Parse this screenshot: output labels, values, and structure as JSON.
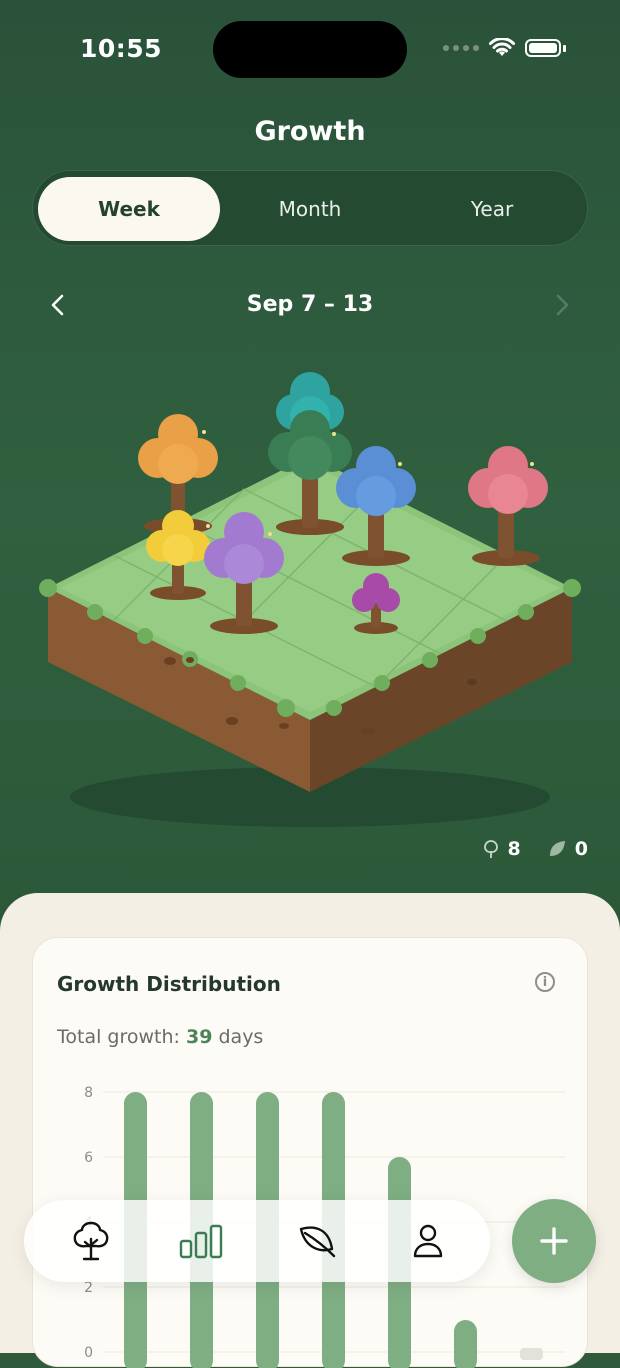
{
  "status_bar": {
    "time": "10:55"
  },
  "header": {
    "title": "Growth"
  },
  "segments": [
    {
      "label": "Week",
      "active": true
    },
    {
      "label": "Month",
      "active": false
    },
    {
      "label": "Year",
      "active": false
    }
  ],
  "range": {
    "label": "Sep 7 – 13",
    "prev_icon": "chevron-left-icon",
    "next_icon": "chevron-right-icon"
  },
  "counters": {
    "trees": "8",
    "leaves": "0"
  },
  "distribution": {
    "title": "Growth Distribution",
    "total_prefix": "Total growth:",
    "total_value": "39",
    "total_suffix": "days"
  },
  "chart_data": {
    "type": "bar",
    "y_ticks": [
      "8",
      "6",
      "4",
      "2",
      "0"
    ],
    "values": [
      8,
      8,
      8,
      8,
      6,
      0,
      0
    ],
    "ylim": [
      0,
      8
    ],
    "bar_color": "#7fae83"
  },
  "tabs": [
    {
      "name": "forest",
      "icon": "tree-icon",
      "active": true
    },
    {
      "name": "stats",
      "icon": "bar-chart-icon",
      "active": false
    },
    {
      "name": "leaf",
      "icon": "leaf-icon",
      "active": false
    },
    {
      "name": "profile",
      "icon": "person-icon",
      "active": false
    }
  ],
  "fab": {
    "icon": "plus-icon"
  },
  "colors": {
    "accent": "#7fae83",
    "dark_green": "#2f5a3b"
  }
}
